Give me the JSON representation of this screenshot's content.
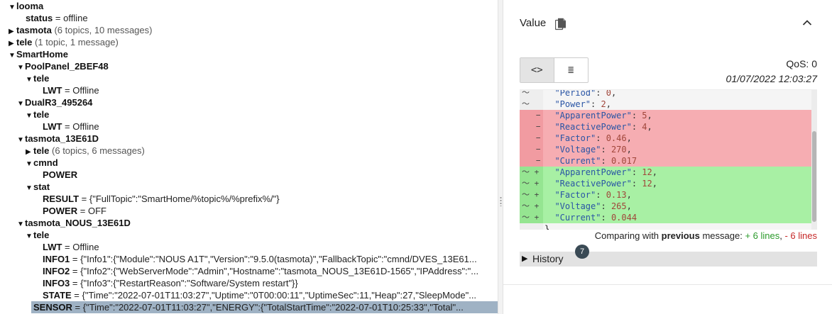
{
  "tree": {
    "rows": [
      {
        "arrow": "▼",
        "key": "looma",
        "eq": "",
        "val": "",
        "meta": ""
      },
      {
        "arrow": "",
        "key": "status",
        "eq": " = ",
        "val": "offline",
        "meta": ""
      },
      {
        "arrow": "▶",
        "key": "tasmota",
        "eq": "",
        "val": "",
        "meta": " (6 topics, 10 messages)"
      },
      {
        "arrow": "▶",
        "key": "tele",
        "eq": "",
        "val": "",
        "meta": " (1 topic, 1 message)"
      },
      {
        "arrow": "▼",
        "key": "SmartHome",
        "eq": "",
        "val": "",
        "meta": ""
      },
      {
        "arrow": "▼",
        "key": "PoolPanel_2BEF48",
        "eq": "",
        "val": "",
        "meta": ""
      },
      {
        "arrow": "▼",
        "key": "tele",
        "eq": "",
        "val": "",
        "meta": ""
      },
      {
        "arrow": "",
        "key": "LWT",
        "eq": " = ",
        "val": "Offline",
        "meta": ""
      },
      {
        "arrow": "▼",
        "key": "DualR3_495264",
        "eq": "",
        "val": "",
        "meta": ""
      },
      {
        "arrow": "▼",
        "key": "tele",
        "eq": "",
        "val": "",
        "meta": ""
      },
      {
        "arrow": "",
        "key": "LWT",
        "eq": " = ",
        "val": "Offline",
        "meta": ""
      },
      {
        "arrow": "▼",
        "key": "tasmota_13E61D",
        "eq": "",
        "val": "",
        "meta": ""
      },
      {
        "arrow": "▶",
        "key": "tele",
        "eq": "",
        "val": "",
        "meta": " (6 topics, 6 messages)"
      },
      {
        "arrow": "▼",
        "key": "cmnd",
        "eq": "",
        "val": "",
        "meta": ""
      },
      {
        "arrow": "",
        "key": "POWER",
        "eq": "",
        "val": "",
        "meta": ""
      },
      {
        "arrow": "▼",
        "key": "stat",
        "eq": "",
        "val": "",
        "meta": ""
      },
      {
        "arrow": "",
        "key": "RESULT",
        "eq": " = ",
        "val": "{\"FullTopic\":\"SmartHome/%topic%/%prefix%/\"}",
        "meta": ""
      },
      {
        "arrow": "",
        "key": "POWER",
        "eq": " = ",
        "val": "OFF",
        "meta": ""
      },
      {
        "arrow": "▼",
        "key": "tasmota_NOUS_13E61D",
        "eq": "",
        "val": "",
        "meta": ""
      },
      {
        "arrow": "▼",
        "key": "tele",
        "eq": "",
        "val": "",
        "meta": ""
      },
      {
        "arrow": "",
        "key": "LWT",
        "eq": " = ",
        "val": "Offline",
        "meta": ""
      },
      {
        "arrow": "",
        "key": "INFO1",
        "eq": " = ",
        "val": "{\"Info1\":{\"Module\":\"NOUS A1T\",\"Version\":\"9.5.0(tasmota)\",\"FallbackTopic\":\"cmnd/DVES_13E61...",
        "meta": ""
      },
      {
        "arrow": "",
        "key": "INFO2",
        "eq": " = ",
        "val": "{\"Info2\":{\"WebServerMode\":\"Admin\",\"Hostname\":\"tasmota_NOUS_13E61D-1565\",\"IPAddress\":\"...",
        "meta": ""
      },
      {
        "arrow": "",
        "key": "INFO3",
        "eq": " = ",
        "val": "{\"Info3\":{\"RestartReason\":\"Software/System restart\"}}",
        "meta": ""
      },
      {
        "arrow": "",
        "key": "STATE",
        "eq": " = ",
        "val": "{\"Time\":\"2022-07-01T11:03:27\",\"Uptime\":\"0T00:00:11\",\"UptimeSec\":11,\"Heap\":27,\"SleepMode\"...",
        "meta": ""
      },
      {
        "arrow": "",
        "key": "SENSOR",
        "eq": " = ",
        "val": "{\"Time\":\"2022-07-01T11:03:27\",\"ENERGY\":{\"TotalStartTime\":\"2022-07-01T10:25:33\",\"Total\"...",
        "meta": ""
      }
    ]
  },
  "panel": {
    "title": "Value",
    "qos": "QoS: 0",
    "timestamp": "01/07/2022 12:03:27",
    "view_toggle": {
      "code_label": "<>",
      "list_label": "≣"
    },
    "diff_lines": [
      {
        "type": "ctx",
        "gutter": "〜",
        "code": "  \"Period\": 0,"
      },
      {
        "type": "ctx",
        "gutter": "〜",
        "code": "  \"Power\": 2,"
      },
      {
        "type": "rem",
        "gutter": "   −",
        "code": "  \"ApparentPower\": 5,"
      },
      {
        "type": "rem",
        "gutter": "   −",
        "code": "  \"ReactivePower\": 4,"
      },
      {
        "type": "rem",
        "gutter": "   −",
        "code": "  \"Factor\": 0.46,"
      },
      {
        "type": "rem",
        "gutter": "   −",
        "code": "  \"Voltage\": 270,"
      },
      {
        "type": "rem",
        "gutter": "   −",
        "code": "  \"Current\": 0.017"
      },
      {
        "type": "add",
        "gutter": "〜 +",
        "code": "  \"ApparentPower\": 12,"
      },
      {
        "type": "add",
        "gutter": "〜 +",
        "code": "  \"ReactivePower\": 12,"
      },
      {
        "type": "add",
        "gutter": "〜 +",
        "code": "  \"Factor\": 0.13,"
      },
      {
        "type": "add",
        "gutter": "〜 +",
        "code": "  \"Voltage\": 265,"
      },
      {
        "type": "add",
        "gutter": "〜 +",
        "code": "  \"Current\": 0.044"
      },
      {
        "type": "ctx",
        "gutter": "",
        "code": "}"
      }
    ],
    "compare": {
      "prefix": "Comparing with ",
      "bold": "previous",
      "middle": " message: ",
      "added": "+ 6 lines",
      "sep": ", ",
      "removed": "- 6 lines"
    },
    "history": {
      "label": "History",
      "count": "7"
    }
  },
  "colors": {
    "removed_bg": "#f6adb2",
    "added_bg": "#a8f0a4",
    "selected_row": "#9fb2c4",
    "json_key": "#2a55a5",
    "json_number": "#a0463a"
  },
  "icons": [
    "copy-icon",
    "chevron-up-icon",
    "code-view-icon",
    "list-view-icon",
    "triangle-right-icon"
  ]
}
